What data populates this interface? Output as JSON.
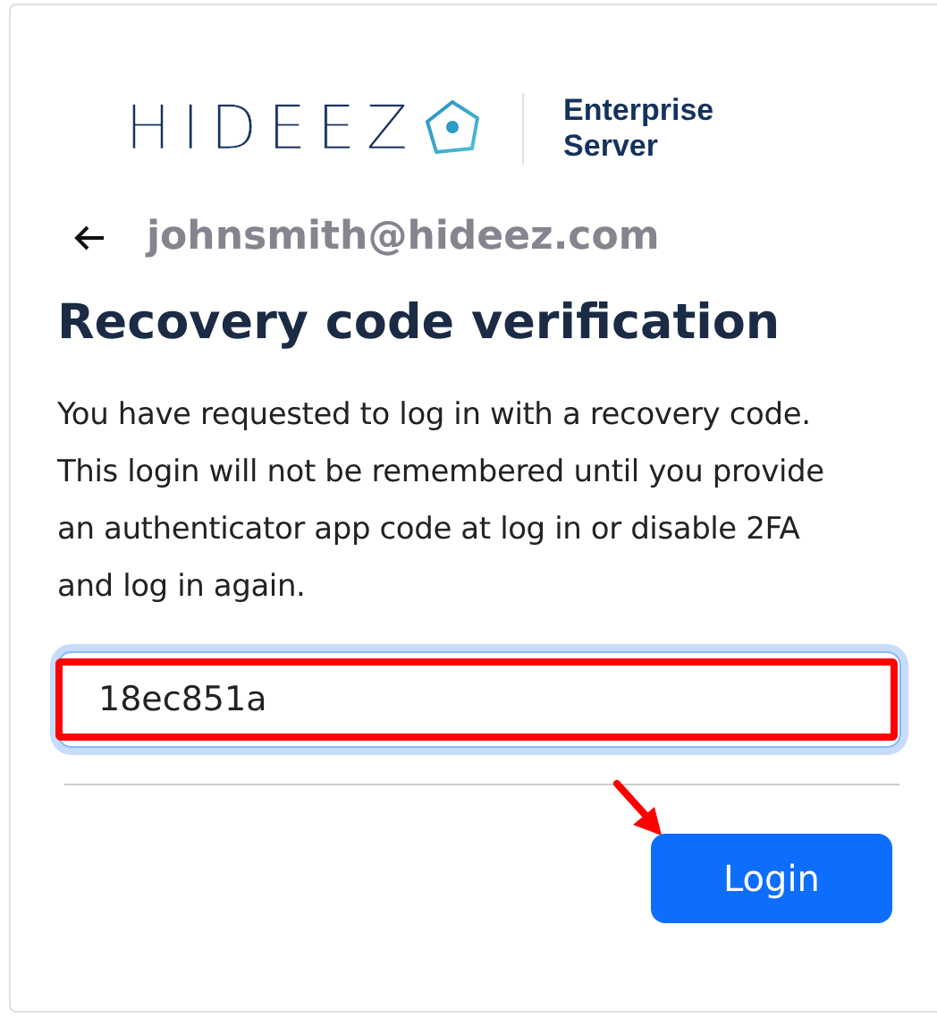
{
  "logo": {
    "wordmark": "HIDEEZ",
    "product_lines": [
      "Enterprise",
      "Server"
    ]
  },
  "back_link": {
    "email": "johnsmith@hideez.com"
  },
  "heading": "Recovery code verification",
  "message": "You have requested to log in with a recovery code. This login will not be remembered until you provide an authenticator app code at log in or disable 2FA and log in again.",
  "recovery_code_field": {
    "value": "18ec851a",
    "focused": true
  },
  "buttons": [
    {
      "label": "Login",
      "kind": "primary"
    }
  ]
}
